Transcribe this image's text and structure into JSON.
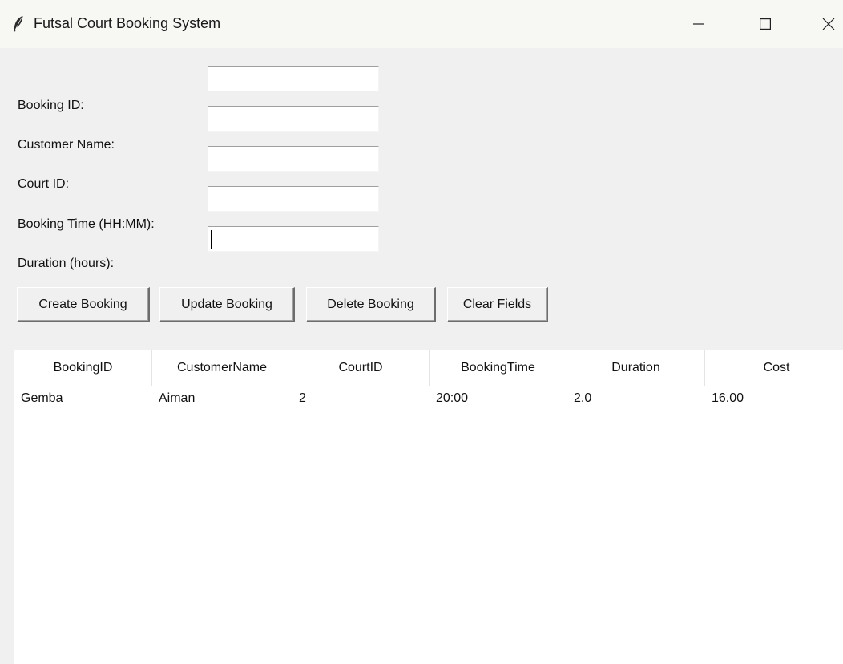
{
  "window": {
    "title": "Futsal Court Booking System"
  },
  "form": {
    "booking_id": {
      "label": "Booking ID:",
      "value": ""
    },
    "customer_name": {
      "label": "Customer Name:",
      "value": ""
    },
    "court_id": {
      "label": "Court ID:",
      "value": ""
    },
    "booking_time": {
      "label": "Booking Time (HH:MM):",
      "value": ""
    },
    "duration": {
      "label": "Duration (hours):",
      "value": ""
    }
  },
  "buttons": {
    "create": "Create Booking",
    "update": "Update Booking",
    "delete": "Delete Booking",
    "clear": "Clear Fields"
  },
  "table": {
    "columns": [
      "BookingID",
      "CustomerName",
      "CourtID",
      "BookingTime",
      "Duration",
      "Cost"
    ],
    "rows": [
      [
        "Gemba",
        "Aiman",
        "2",
        "20:00",
        "2.0",
        "16.00"
      ]
    ]
  }
}
